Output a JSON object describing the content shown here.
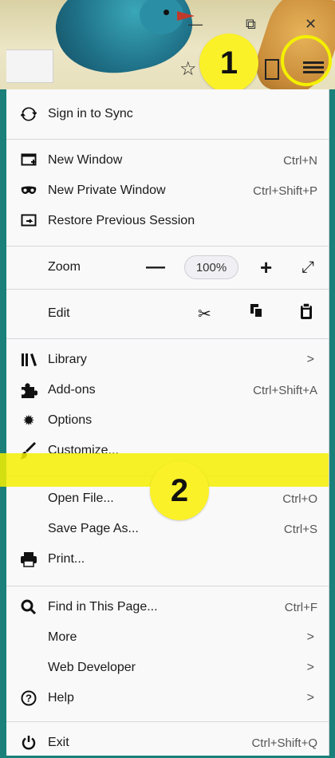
{
  "toolbar": {
    "badge1": "1",
    "badge2": "2",
    "minimize": "—",
    "restore": "⧉",
    "close": "✕"
  },
  "menu": {
    "sync": "Sign in to Sync",
    "new_window": {
      "label": "New Window",
      "shortcut": "Ctrl+N"
    },
    "new_private": {
      "label": "New Private Window",
      "shortcut": "Ctrl+Shift+P"
    },
    "restore_session": {
      "label": "Restore Previous Session"
    },
    "zoom": {
      "label": "Zoom",
      "value": "100%",
      "minus": "—",
      "plus": "+"
    },
    "edit": {
      "label": "Edit"
    },
    "library": {
      "label": "Library",
      "arrow": ">"
    },
    "addons": {
      "label": "Add-ons",
      "shortcut": "Ctrl+Shift+A"
    },
    "options": {
      "label": "Options"
    },
    "customize": {
      "label": "Customize..."
    },
    "open_file": {
      "label": "Open File...",
      "shortcut": "Ctrl+O"
    },
    "save_page": {
      "label": "Save Page As...",
      "shortcut": "Ctrl+S"
    },
    "print": {
      "label": "Print..."
    },
    "find": {
      "label": "Find in This Page...",
      "shortcut": "Ctrl+F"
    },
    "more": {
      "label": "More",
      "arrow": ">"
    },
    "web_dev": {
      "label": "Web Developer",
      "arrow": ">"
    },
    "help": {
      "label": "Help",
      "arrow": ">"
    },
    "exit": {
      "label": "Exit",
      "shortcut": "Ctrl+Shift+Q"
    }
  },
  "colors": {
    "highlight": "#f4f000",
    "badge": "#fbf128",
    "frame": "#1b7f7a"
  }
}
